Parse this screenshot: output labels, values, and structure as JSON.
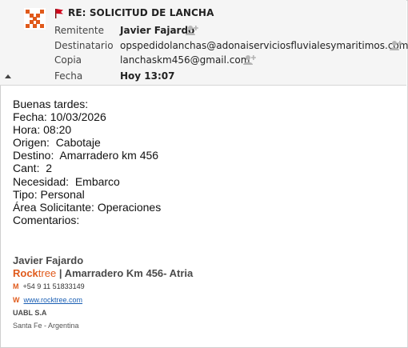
{
  "header": {
    "subject": "RE: SOLICITUD DE LANCHA",
    "fields": {
      "from_label": "Remitente",
      "from_value": "Javier Fajardo",
      "to_label": "Destinatario",
      "to_value": "opspedidolanchas@adonaiserviciosfluvialesymaritimos.com",
      "cc_label": "Copia",
      "cc_value": "lanchaskm456@gmail.com",
      "date_label": "Fecha",
      "date_value": "Hoy 13:07"
    },
    "icons": {
      "logo": "company-logo-icon",
      "flag": "red-flag-icon",
      "add_contact": "add-contact-icon",
      "collapse": "collapse-triangle-icon"
    }
  },
  "body": {
    "lines": [
      "Buenas tardes:",
      "Fecha: 10/03/2026",
      "Hora: 08:20",
      "Origen:  Cabotaje",
      "Destino:  Amarradero km 456",
      "Cant:  2",
      "Necesidad:  Embarco",
      "Tipo: Personal",
      "Área Solicitante: Operaciones",
      "Comentarios:"
    ]
  },
  "signature": {
    "name": "Javier Fajardo",
    "brand_rock": "Rock",
    "brand_tree": "tree",
    "separator": " | ",
    "location": "Amarradero Km 456- Atria",
    "phone_key": "M",
    "phone": "+54 9 11 51833149",
    "web_key": "W",
    "web": "www.rocktree.com",
    "company": "UABL S.A",
    "city": "Santa Fe - Argentina"
  },
  "colors": {
    "accent_orange": "#e05a1b",
    "flag_red": "#d0021b",
    "link_blue": "#1a5fb4",
    "header_bg": "#f5f5f5"
  }
}
